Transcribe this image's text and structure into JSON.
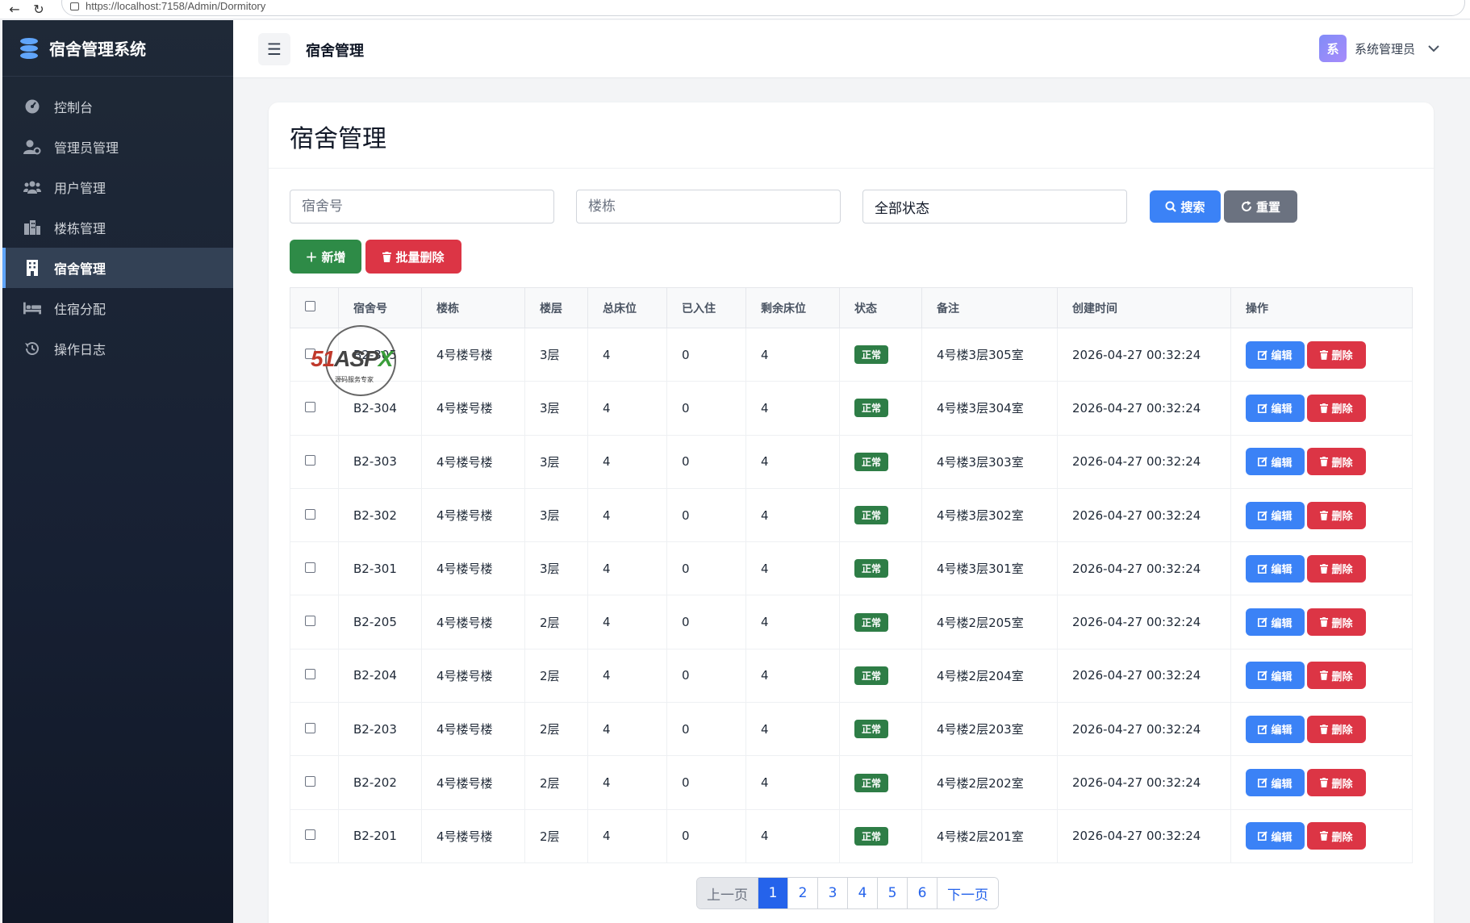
{
  "browser": {
    "url": "https://localhost:7158/Admin/Dormitory"
  },
  "sidebar": {
    "brand": "宿舍管理系统",
    "items": [
      {
        "label": "控制台",
        "icon": "dashboard-gauge-icon"
      },
      {
        "label": "管理员管理",
        "icon": "user-gear-icon"
      },
      {
        "label": "用户管理",
        "icon": "users-icon"
      },
      {
        "label": "楼栋管理",
        "icon": "city-buildings-icon"
      },
      {
        "label": "宿舍管理",
        "icon": "building-icon",
        "active": true
      },
      {
        "label": "住宿分配",
        "icon": "bed-icon"
      },
      {
        "label": "操作日志",
        "icon": "history-icon"
      }
    ]
  },
  "header": {
    "title": "宿舍管理",
    "user": {
      "avatar": "系",
      "name": "系统管理员"
    }
  },
  "page": {
    "title": "宿舍管理",
    "filters": {
      "room_placeholder": "宿舍号",
      "building_placeholder": "楼栋",
      "status_selected": "全部状态",
      "search_label": "搜索",
      "reset_label": "重置"
    },
    "actions": {
      "add_label": "新增",
      "batch_delete_label": "批量删除"
    }
  },
  "table": {
    "columns": [
      "宿舍号",
      "楼栋",
      "楼层",
      "总床位",
      "已入住",
      "剩余床位",
      "状态",
      "备注",
      "创建时间",
      "操作"
    ],
    "edit_label": "编辑",
    "delete_label": "删除",
    "rows": [
      {
        "room": "B2-305",
        "building": "4号楼号楼",
        "floor": "3层",
        "total": "4",
        "occupied": "0",
        "remaining": "4",
        "status": "正常",
        "note": "4号楼3层305室",
        "created": "2026-04-27 00:32:24"
      },
      {
        "room": "B2-304",
        "building": "4号楼号楼",
        "floor": "3层",
        "total": "4",
        "occupied": "0",
        "remaining": "4",
        "status": "正常",
        "note": "4号楼3层304室",
        "created": "2026-04-27 00:32:24"
      },
      {
        "room": "B2-303",
        "building": "4号楼号楼",
        "floor": "3层",
        "total": "4",
        "occupied": "0",
        "remaining": "4",
        "status": "正常",
        "note": "4号楼3层303室",
        "created": "2026-04-27 00:32:24"
      },
      {
        "room": "B2-302",
        "building": "4号楼号楼",
        "floor": "3层",
        "total": "4",
        "occupied": "0",
        "remaining": "4",
        "status": "正常",
        "note": "4号楼3层302室",
        "created": "2026-04-27 00:32:24"
      },
      {
        "room": "B2-301",
        "building": "4号楼号楼",
        "floor": "3层",
        "total": "4",
        "occupied": "0",
        "remaining": "4",
        "status": "正常",
        "note": "4号楼3层301室",
        "created": "2026-04-27 00:32:24"
      },
      {
        "room": "B2-205",
        "building": "4号楼号楼",
        "floor": "2层",
        "total": "4",
        "occupied": "0",
        "remaining": "4",
        "status": "正常",
        "note": "4号楼2层205室",
        "created": "2026-04-27 00:32:24"
      },
      {
        "room": "B2-204",
        "building": "4号楼号楼",
        "floor": "2层",
        "total": "4",
        "occupied": "0",
        "remaining": "4",
        "status": "正常",
        "note": "4号楼2层204室",
        "created": "2026-04-27 00:32:24"
      },
      {
        "room": "B2-203",
        "building": "4号楼号楼",
        "floor": "2层",
        "total": "4",
        "occupied": "0",
        "remaining": "4",
        "status": "正常",
        "note": "4号楼2层203室",
        "created": "2026-04-27 00:32:24"
      },
      {
        "room": "B2-202",
        "building": "4号楼号楼",
        "floor": "2层",
        "total": "4",
        "occupied": "0",
        "remaining": "4",
        "status": "正常",
        "note": "4号楼2层202室",
        "created": "2026-04-27 00:32:24"
      },
      {
        "room": "B2-201",
        "building": "4号楼号楼",
        "floor": "2层",
        "total": "4",
        "occupied": "0",
        "remaining": "4",
        "status": "正常",
        "note": "4号楼2层201室",
        "created": "2026-04-27 00:32:24"
      }
    ]
  },
  "pagination": {
    "prev": "上一页",
    "next": "下一页",
    "pages": [
      "1",
      "2",
      "3",
      "4",
      "5",
      "6"
    ],
    "current": "1"
  },
  "watermark": {
    "logo": "51ASPX",
    "tagline": "源码服务专家"
  },
  "colors": {
    "primary": "#3b82f6",
    "success": "#2e8b47",
    "danger": "#dc3545",
    "secondary": "#6b7280",
    "sidebar": "#1f2937"
  }
}
